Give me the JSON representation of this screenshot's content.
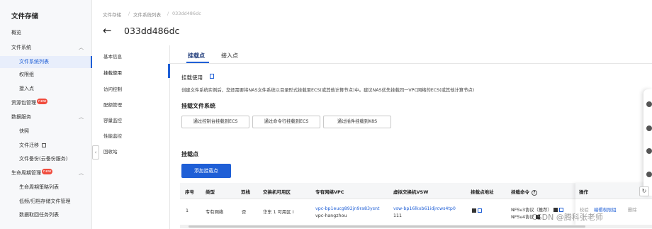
{
  "sidebar": {
    "title": "文件存储",
    "items": [
      {
        "label": "概览",
        "badge": "",
        "chevron": ""
      },
      {
        "label": "文件系统",
        "badge": "",
        "chevron": "^"
      },
      {
        "label": "文件系统列表",
        "badge": "",
        "chevron": ""
      },
      {
        "label": "权限组",
        "badge": "",
        "chevron": ""
      },
      {
        "label": "接入点",
        "badge": "",
        "chevron": ""
      },
      {
        "label": "资源包管理",
        "badge": "new",
        "chevron": ""
      },
      {
        "label": "数据服务",
        "badge": "",
        "chevron": "^"
      },
      {
        "label": "快照",
        "badge": "",
        "chevron": ""
      },
      {
        "label": "文件迁移",
        "badge": "",
        "chevron": ""
      },
      {
        "label": "文件备份(云备份服务)",
        "badge": "",
        "chevron": ""
      },
      {
        "label": "生命周期管理",
        "badge": "new",
        "chevron": "^"
      },
      {
        "label": "生命周期策略列表",
        "badge": "",
        "chevron": ""
      },
      {
        "label": "低频/归档存储文件管理",
        "badge": "",
        "chevron": ""
      },
      {
        "label": "数据取回任务列表",
        "badge": "",
        "chevron": ""
      }
    ],
    "active_index": 2
  },
  "breadcrumb": [
    "文件存储",
    "文件系统列表",
    "033dd486dc"
  ],
  "header": {
    "title": "033dd486dc"
  },
  "submenu": {
    "items": [
      "基本信息",
      "挂载使用",
      "访问控制",
      "配额管理",
      "容量监控",
      "性能监控",
      "回收站"
    ],
    "active_index": 1
  },
  "tabs": [
    {
      "label": "挂载点"
    },
    {
      "label": "接入点"
    }
  ],
  "mount_usage": {
    "heading": "挂载使用",
    "description": "创建文件系统实例后，您还需要将NAS文件系统以目录形式挂载至ECS(或其他计算节点)中。建议NAS优先挂载同一VPC网络的ECS(或其他计算节点)",
    "mount_heading": "挂载文件系统",
    "options": [
      "通过控制台挂载到ECS",
      "通过命令行挂载到ECS",
      "通过插件挂载到K8S"
    ]
  },
  "mount_points": {
    "heading": "挂载点",
    "add_button": "添加挂载点",
    "columns": [
      "序号",
      "类型",
      "双栈",
      "交换机可用区",
      "专有网络VPC",
      "虚拟交换机VSW",
      "挂载点地址",
      "挂载命令",
      "操作"
    ],
    "rows": [
      {
        "index": "1",
        "type": "专有网络",
        "dual_stack": "否",
        "zone": "华东 1 可用区 I",
        "vpc_id": "vpc-bp1eucg892jn9ra83ysnt",
        "vpc_name": "vpc-hangzhou",
        "vsw_id": "vsw-bp16lkxb61idjrcws4tp0",
        "vsw_name": "111",
        "cmd_1": "NFSv3协议（推荐）",
        "cmd_2": "NFSv4协议",
        "ops": [
          "校验",
          "编辑权限组",
          "删除"
        ]
      }
    ]
  },
  "watermark": "CSDN @腾科张老师",
  "colors": {
    "accent": "#1f5fd6",
    "badge": "#f04b3c"
  }
}
